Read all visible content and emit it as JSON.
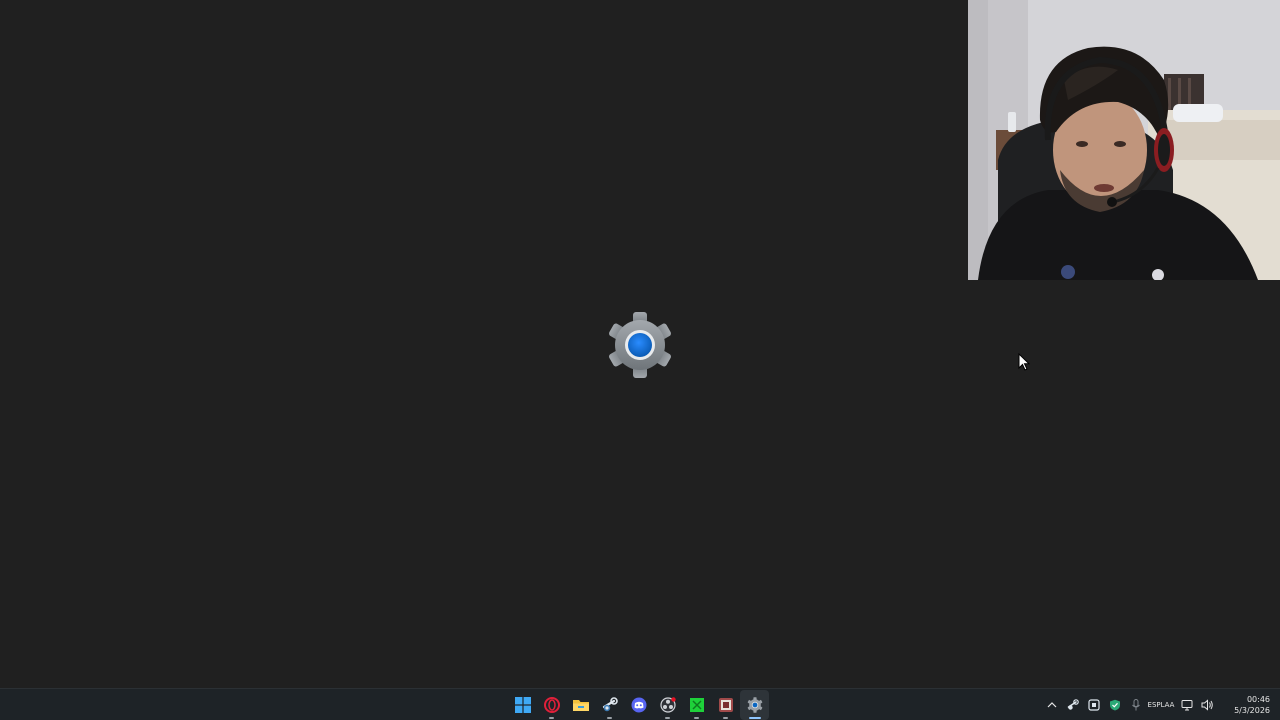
{
  "desktop": {
    "splash_icon": "settings-gear-icon",
    "background_color": "#202020"
  },
  "webcam": {
    "content": "webcam-feed"
  },
  "taskbar": {
    "pinned": [
      {
        "icon": "windows-start-icon",
        "active": false
      },
      {
        "icon": "opera-gx-icon",
        "active": false
      },
      {
        "icon": "file-explorer-icon",
        "active": false
      },
      {
        "icon": "steam-icon",
        "active": false
      },
      {
        "icon": "discord-icon",
        "active": false
      },
      {
        "icon": "obs-icon",
        "active": false
      },
      {
        "icon": "green-app-icon",
        "active": false
      },
      {
        "icon": "game-app-icon",
        "active": false
      },
      {
        "icon": "settings-icon",
        "active": true
      }
    ],
    "tray": {
      "language_line1": "ESP",
      "language_line2": "LAA",
      "time": "00:46",
      "date": "5/3/2026"
    }
  },
  "colors": {
    "taskbar_bg": "#1e2327",
    "accent": "#0078d4",
    "gear": "#8a8f94"
  }
}
